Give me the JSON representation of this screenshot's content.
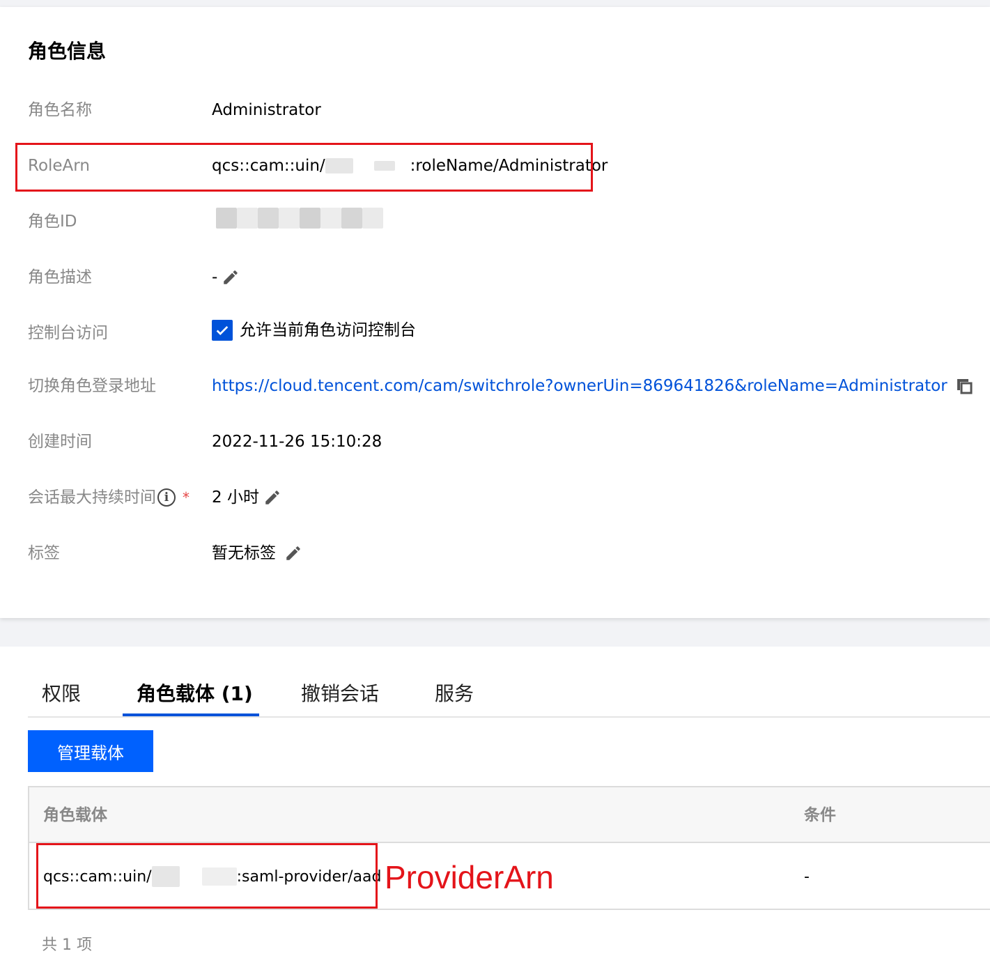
{
  "role_info": {
    "title": "角色信息",
    "fields": {
      "role_name": {
        "label": "角色名称",
        "value": "Administrator"
      },
      "role_arn": {
        "label": "RoleArn",
        "prefix": "qcs::cam::uin/",
        "suffix": ":roleName/Administrator"
      },
      "role_id": {
        "label": "角色ID"
      },
      "role_desc": {
        "label": "角色描述",
        "value": "-"
      },
      "console_access": {
        "label": "控制台访问",
        "checkbox_label": "允许当前角色访问控制台",
        "checked": true
      },
      "switch_url": {
        "label": "切换角色登录地址",
        "url": "https://cloud.tencent.com/cam/switchrole?ownerUin=869641826&roleName=Administrator"
      },
      "created_at": {
        "label": "创建时间",
        "value": "2022-11-26 15:10:28"
      },
      "max_session": {
        "label": "会话最大持续时间",
        "required_mark": "*",
        "value": "2 小时"
      },
      "tags": {
        "label": "标签",
        "value": "暂无标签"
      }
    }
  },
  "tabs": [
    {
      "label": "权限",
      "active": false
    },
    {
      "label": "角色载体 (1)",
      "active": true
    },
    {
      "label": "撤销会话",
      "active": false
    },
    {
      "label": "服务",
      "active": false
    }
  ],
  "manage_button": "管理载体",
  "table": {
    "headers": [
      "角色载体",
      "条件"
    ],
    "rows": [
      {
        "carrier_prefix": "qcs::cam::uin/",
        "carrier_suffix": ":saml-provider/aad",
        "condition": "-"
      }
    ]
  },
  "annotation": "ProviderArn",
  "total": "共 1 项",
  "colors": {
    "accent": "#0052d9",
    "highlight": "#e4141a",
    "button": "#0061fe"
  },
  "icons": [
    "edit-icon",
    "check-icon",
    "copy-icon",
    "info-icon"
  ]
}
